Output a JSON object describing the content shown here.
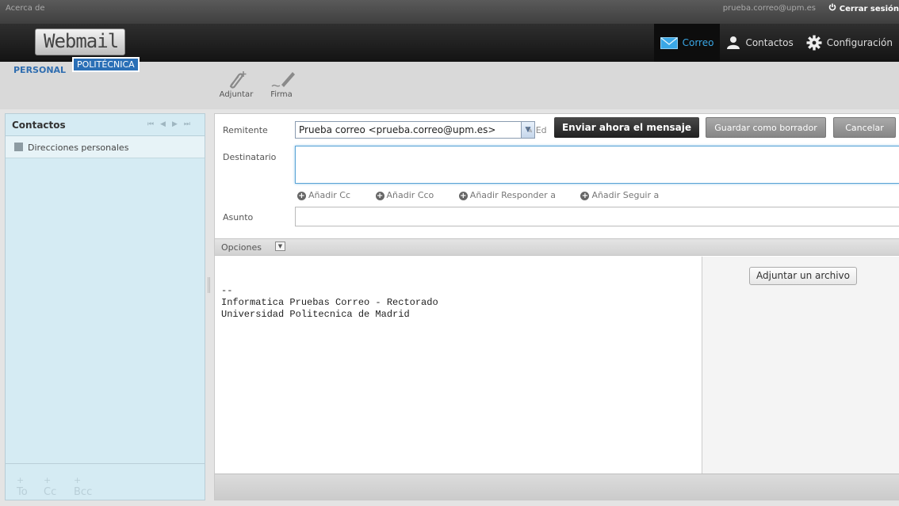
{
  "topbar": {
    "about": "Acerca de",
    "user_email": "prueba.correo@upm.es",
    "logout": "Cerrar sesión"
  },
  "logo": {
    "name": "Webmail",
    "badge": "POLITÉCNICA",
    "subtitle": "PERSONAL"
  },
  "nav": {
    "mail": "Correo",
    "contacts": "Contactos",
    "settings": "Configuración"
  },
  "toolbar": {
    "attach": "Adjuntar",
    "signature": "Firma"
  },
  "contacts_panel": {
    "title": "Contactos",
    "items": [
      {
        "label": "Direcciones personales"
      }
    ],
    "footer": {
      "to": "To",
      "cc": "Cc",
      "bcc": "Bcc"
    }
  },
  "compose": {
    "from_label": "Remitente",
    "from_value": "Prueba correo <prueba.correo@upm.es>",
    "edit_link": "Ed",
    "send_button": "Enviar ahora el mensaje",
    "draft_button": "Guardar como borrador",
    "cancel_button": "Cancelar",
    "to_label": "Destinatario",
    "to_value": "",
    "add_cc": "Añadir Cc",
    "add_bcc": "Añadir Cco",
    "add_reply_to": "Añadir Responder a",
    "add_followup_to": "Añadir Seguir a",
    "subject_label": "Asunto",
    "subject_value": "",
    "options_label": "Opciones",
    "body": "--\nInformatica Pruebas Correo - Rectorado\nUniversidad Politecnica de Madrid",
    "attach_file_button": "Adjuntar un archivo"
  },
  "colors": {
    "accent_blue": "#3aa7e6",
    "panel_bg": "#d5ebf3",
    "header_dark": "#1a1a1a"
  }
}
